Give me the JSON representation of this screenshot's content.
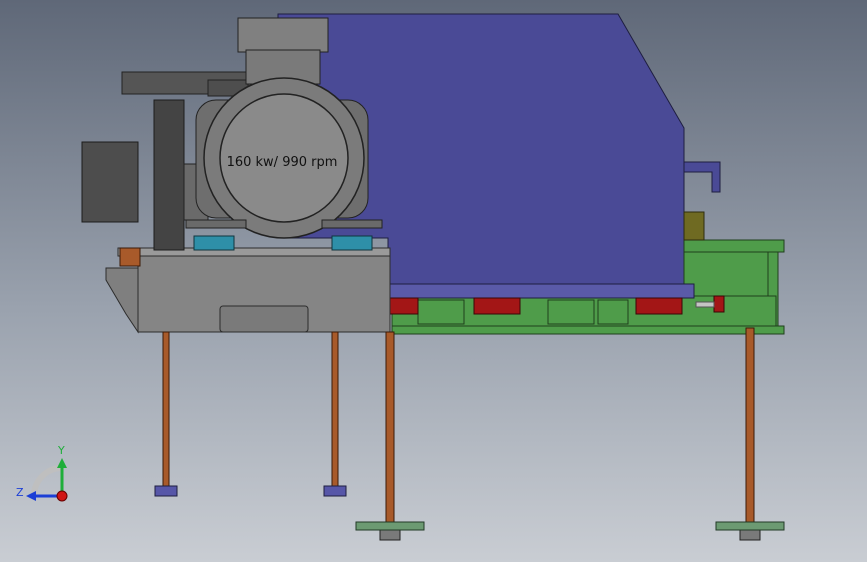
{
  "motor": {
    "rating_label": "160 kw/ 990 rpm"
  },
  "triad": {
    "y_label": "Y",
    "z_label": "Z",
    "y_color": "#1fae3a",
    "z_color": "#1c3fd6",
    "x_color": "#d01515"
  },
  "colors": {
    "housing_blue": "#4a4a96",
    "frame_green": "#4f9c4a",
    "motor_grey": "#7b7b7b",
    "base_grey": "#858585",
    "pad_teal": "#2e8fa8",
    "block_red": "#a31616",
    "rod_rust": "#a85a2a",
    "foot_plate": "#6c9a72",
    "nut_blue": "#5656a8"
  }
}
